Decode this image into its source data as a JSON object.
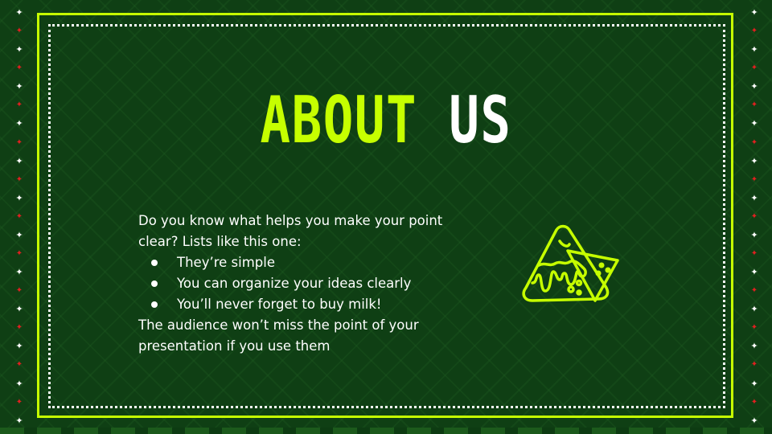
{
  "slide": {
    "title_word1": "ABOUT",
    "title_word2": "US",
    "intro": "Do you know what helps you make your point clear? Lists like this one:",
    "bullets": [
      "They’re simple",
      "You can organize your ideas clearly",
      "You’ll never forget to buy milk!"
    ],
    "closing": "The audience won’t miss the point of your presentation  if you use them"
  },
  "icons": {
    "illustration": "nachos-with-cheese-icon",
    "border_decoration": "star-icon"
  },
  "colors": {
    "background": "#0f3f14",
    "accent": "#c6ff00",
    "text": "#ffffff",
    "star_red": "#e02020"
  }
}
